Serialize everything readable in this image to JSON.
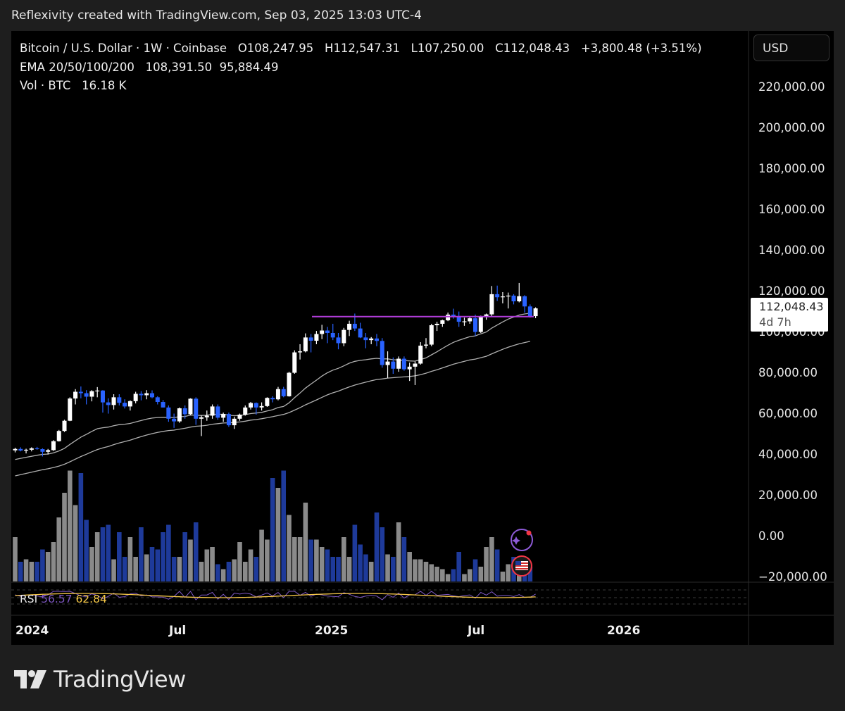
{
  "header": {
    "attribution": "Reflexivity created with TradingView.com, Sep 03, 2025 13:03 UTC-4"
  },
  "legend": {
    "symbol": "Bitcoin / U.S. Dollar · 1W · Coinbase",
    "open": "O108,247.95",
    "high": "H112,547.31",
    "low": "L107,250.00",
    "close": "C112,048.43",
    "change": "+3,800.48 (+3.51%)",
    "ema_label": "EMA 20/50/100/200",
    "ema_values": "108,391.50  95,884.49",
    "vol_label": "Vol · BTC",
    "vol_value": "16.18 K"
  },
  "currency_button": "USD",
  "price_tag": {
    "price": "112,048.43",
    "countdown": "4d 7h"
  },
  "rsi": {
    "label": "RSI",
    "value1": "56.57",
    "value2": "62.84",
    "color1": "#7e57c2",
    "color2": "#f7c948"
  },
  "brand": {
    "name": "TradingView"
  },
  "colors": {
    "up": "#ffffff",
    "down": "#2962ff",
    "vol_up": "#8a8a8a",
    "vol_down": "#1e3a9a",
    "ema": "#b0b0b0",
    "resistance": "#b03cd8",
    "background": "#000000"
  },
  "chart_data": {
    "type": "candlestick",
    "title": "Bitcoin / U.S. Dollar · 1W · Coinbase",
    "y_ticks": [
      "220,000.00",
      "200,000.00",
      "180,000.00",
      "160,000.00",
      "140,000.00",
      "120,000.00",
      "100,000.00",
      "80,000.00",
      "60,000.00",
      "40,000.00",
      "20,000.00",
      "0.00",
      "−20,000.00"
    ],
    "x_ticks": [
      "2024",
      "Jul",
      "2025",
      "Jul",
      "2026"
    ],
    "ylim": [
      -20000,
      220000
    ],
    "resistance_level": 108000,
    "candles": [
      [
        42500,
        43800,
        41500,
        43200
      ],
      [
        43200,
        44000,
        42000,
        42400
      ],
      [
        42400,
        43300,
        41000,
        42800
      ],
      [
        42800,
        44000,
        42000,
        43500
      ],
      [
        43500,
        44200,
        42800,
        43100
      ],
      [
        43100,
        43500,
        39500,
        41800
      ],
      [
        41800,
        43200,
        40500,
        42600
      ],
      [
        42600,
        47500,
        42200,
        47000
      ],
      [
        47000,
        52500,
        46800,
        52000
      ],
      [
        52000,
        57500,
        51500,
        57000
      ],
      [
        57000,
        68500,
        56800,
        67900
      ],
      [
        67900,
        72500,
        65000,
        71200
      ],
      [
        71200,
        73800,
        68000,
        70500
      ],
      [
        70500,
        72000,
        65000,
        68800
      ],
      [
        68800,
        72000,
        66500,
        71500
      ],
      [
        71500,
        73500,
        68500,
        71800
      ],
      [
        71800,
        72000,
        61000,
        66000
      ],
      [
        66000,
        68000,
        60500,
        64700
      ],
      [
        64700,
        70000,
        62500,
        68500
      ],
      [
        68500,
        70000,
        64500,
        65800
      ],
      [
        65800,
        67500,
        63000,
        64000
      ],
      [
        64000,
        67000,
        62000,
        66600
      ],
      [
        66600,
        71200,
        65500,
        70200
      ],
      [
        70200,
        71500,
        67000,
        69500
      ],
      [
        69500,
        72000,
        67500,
        70500
      ],
      [
        70500,
        71900,
        68000,
        68500
      ],
      [
        68500,
        69000,
        65000,
        66200
      ],
      [
        66200,
        67200,
        63500,
        63500
      ],
      [
        63500,
        64500,
        56500,
        58000
      ],
      [
        58000,
        60500,
        53500,
        56700
      ],
      [
        56700,
        63500,
        56000,
        63100
      ],
      [
        63100,
        64500,
        58000,
        60200
      ],
      [
        60200,
        68000,
        59800,
        67800
      ],
      [
        67800,
        68500,
        55000,
        58000
      ],
      [
        58000,
        59500,
        49500,
        58700
      ],
      [
        58700,
        62000,
        57000,
        59500
      ],
      [
        59500,
        65000,
        58000,
        64000
      ],
      [
        64000,
        65000,
        57500,
        58500
      ],
      [
        58500,
        61000,
        56500,
        60300
      ],
      [
        60300,
        61000,
        54000,
        54800
      ],
      [
        54800,
        59000,
        53000,
        58000
      ],
      [
        58000,
        60500,
        57000,
        60000
      ],
      [
        60000,
        64500,
        59500,
        63500
      ],
      [
        63500,
        66200,
        62500,
        65700
      ],
      [
        65700,
        66000,
        60000,
        63500
      ],
      [
        63500,
        66000,
        62000,
        64200
      ],
      [
        64200,
        68500,
        63800,
        68200
      ],
      [
        68200,
        69000,
        66000,
        67500
      ],
      [
        67500,
        73600,
        67000,
        72500
      ],
      [
        72500,
        73600,
        68500,
        69000
      ],
      [
        69000,
        81000,
        68800,
        80500
      ],
      [
        80500,
        91500,
        80000,
        90500
      ],
      [
        90500,
        94500,
        87000,
        91000
      ],
      [
        91000,
        99800,
        90500,
        97800
      ],
      [
        97800,
        99500,
        90500,
        96200
      ],
      [
        96200,
        101000,
        94500,
        99500
      ],
      [
        99500,
        104000,
        97000,
        101200
      ],
      [
        101200,
        103000,
        95000,
        100000
      ],
      [
        100000,
        104500,
        96500,
        97800
      ],
      [
        97800,
        100000,
        92000,
        95000
      ],
      [
        95000,
        102500,
        93500,
        101500
      ],
      [
        101500,
        106000,
        98500,
        104500
      ],
      [
        104500,
        109500,
        101000,
        102200
      ],
      [
        102200,
        105000,
        97500,
        97800
      ],
      [
        97800,
        100000,
        92500,
        96500
      ],
      [
        96500,
        98000,
        94500,
        97300
      ],
      [
        97300,
        99500,
        93500,
        96100
      ],
      [
        96100,
        97500,
        83000,
        84300
      ],
      [
        84300,
        91000,
        78000,
        86000
      ],
      [
        86000,
        88000,
        80000,
        82500
      ],
      [
        82500,
        88500,
        81000,
        87400
      ],
      [
        87400,
        88500,
        81500,
        82200
      ],
      [
        82200,
        85500,
        76500,
        83500
      ],
      [
        83500,
        86000,
        74500,
        85000
      ],
      [
        85000,
        95500,
        84500,
        93800
      ],
      [
        93800,
        97500,
        92500,
        94300
      ],
      [
        94300,
        104500,
        93500,
        103800
      ],
      [
        103800,
        105500,
        101000,
        104500
      ],
      [
        104500,
        106500,
        103000,
        106200
      ],
      [
        106200,
        110000,
        105800,
        109000
      ],
      [
        109000,
        111900,
        107000,
        108300
      ],
      [
        108300,
        110500,
        103000,
        105500
      ],
      [
        105500,
        107500,
        103500,
        105700
      ],
      [
        105700,
        108000,
        104500,
        107200
      ],
      [
        107200,
        109000,
        98500,
        100500
      ],
      [
        100500,
        108500,
        100000,
        108000
      ],
      [
        108000,
        109500,
        106500,
        109100
      ],
      [
        109100,
        123000,
        108000,
        119000
      ],
      [
        119000,
        123200,
        115700,
        117500
      ],
      [
        117500,
        120000,
        114500,
        117900
      ],
      [
        117900,
        119800,
        112000,
        118300
      ],
      [
        118300,
        119000,
        114000,
        115500
      ],
      [
        115500,
        124500,
        115000,
        118000
      ],
      [
        118000,
        118500,
        110000,
        113000
      ],
      [
        113000,
        114000,
        107500,
        108250
      ],
      [
        108250,
        112550,
        107250,
        112050
      ]
    ],
    "volumes": [
      18,
      8,
      9,
      8,
      8,
      13,
      12,
      16,
      26,
      36,
      45,
      31,
      44,
      25,
      14,
      20,
      22,
      23,
      9,
      20,
      10,
      18,
      10,
      22,
      11,
      14,
      13,
      20,
      23,
      10,
      10,
      20,
      17,
      24,
      8,
      13,
      14,
      7,
      5,
      8,
      9,
      16,
      8,
      13,
      10,
      21,
      17,
      42,
      38,
      45,
      27,
      18,
      18,
      32,
      17,
      17,
      14,
      13,
      10,
      10,
      18,
      10,
      23,
      15,
      11,
      8,
      28,
      22,
      11,
      10,
      24,
      18,
      12,
      9,
      9,
      8,
      7,
      6,
      5,
      3,
      5,
      12,
      3,
      5,
      9,
      6,
      14,
      18,
      13,
      4,
      7,
      10,
      6,
      5,
      6
    ],
    "ema20": [
      38000,
      38600,
      39100,
      39600,
      40100,
      40500,
      40700,
      41300,
      42200,
      43500,
      45400,
      47200,
      49000,
      50300,
      51800,
      53100,
      53600,
      53900,
      54600,
      55100,
      55300,
      55700,
      56400,
      57100,
      57800,
      58300,
      58600,
      58700,
      58700,
      58600,
      59000,
      59100,
      59800,
      59700,
      59600,
      59700,
      60200,
      60100,
      60200,
      59700,
      59500,
      59600,
      60000,
      60500,
      60800,
      61100,
      61800,
      62400,
      63500,
      64000,
      65800,
      68300,
      70600,
      73000,
      75000,
      76900,
      78900,
      80500,
      81800,
      82700,
      83900,
      85200,
      86100,
      86600,
      86900,
      87300,
      87600,
      87300,
      87300,
      86900,
      86800,
      86500,
      86300,
      86200,
      87000,
      87800,
      89300,
      90800,
      92400,
      94000,
      95400,
      96400,
      97300,
      98200,
      98600,
      99600,
      100500,
      102400,
      103900,
      105400,
      106800,
      107800,
      108800,
      109300,
      109700
    ],
    "ema50": [
      30000,
      30600,
      31200,
      31800,
      32400,
      33000,
      33500,
      34100,
      34800,
      35700,
      36900,
      38200,
      39500,
      40600,
      41800,
      42900,
      43700,
      44400,
      45300,
      46100,
      46800,
      47500,
      48400,
      49200,
      50000,
      50700,
      51300,
      51800,
      52200,
      52400,
      52900,
      53300,
      53900,
      54300,
      54500,
      54800,
      55300,
      55600,
      55900,
      56000,
      56200,
      56400,
      56800,
      57300,
      57600,
      58000,
      58500,
      59000,
      59600,
      60100,
      61000,
      62200,
      63400,
      64800,
      66000,
      67200,
      68500,
      69700,
      70700,
      71500,
      72600,
      73600,
      74500,
      75200,
      75900,
      76600,
      77200,
      77500,
      77900,
      78100,
      78300,
      78500,
      78700,
      79000,
      79600,
      80300,
      81200,
      82000,
      82900,
      83800,
      84700,
      85400,
      86100,
      86800,
      87200,
      87900,
      88600,
      89800,
      90900,
      92000,
      93000,
      93900,
      94700,
      95300,
      95900
    ]
  }
}
